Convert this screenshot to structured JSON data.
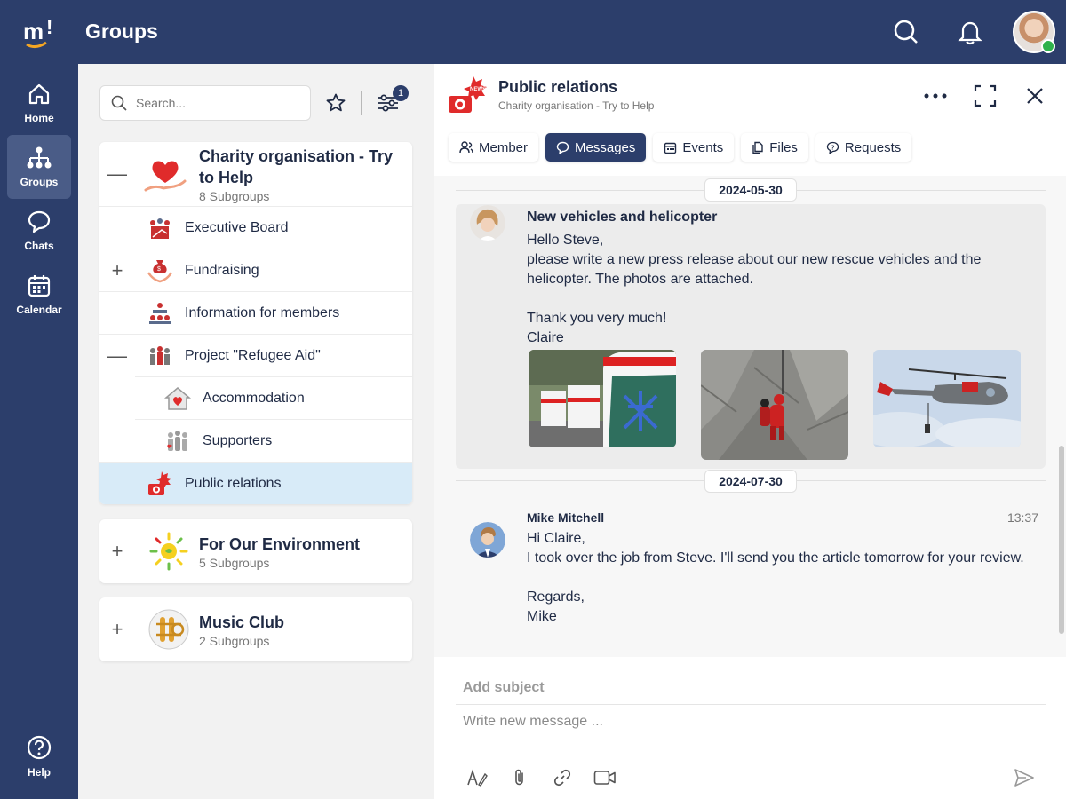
{
  "app": {
    "title": "Groups"
  },
  "nav": {
    "home": "Home",
    "groups": "Groups",
    "chats": "Chats",
    "calendar": "Calendar",
    "help": "Help"
  },
  "search": {
    "placeholder": "Search..."
  },
  "filter": {
    "badge": "1"
  },
  "groups": [
    {
      "title": "Charity organisation - Try to Help",
      "subgroups": "8 Subgroups",
      "children": [
        {
          "label": "Executive Board"
        },
        {
          "label": "Fundraising"
        },
        {
          "label": "Information for members"
        },
        {
          "label": "Project \"Refugee Aid\""
        },
        {
          "label": "Accommodation"
        },
        {
          "label": "Supporters"
        },
        {
          "label": "Public relations"
        }
      ]
    },
    {
      "title": "For Our Environment",
      "subgroups": "5 Subgroups"
    },
    {
      "title": "Music Club",
      "subgroups": "2 Subgroups"
    }
  ],
  "detail": {
    "title": "Public relations",
    "subtitle": "Charity organisation - Try to Help",
    "tabs": [
      "Member",
      "Messages",
      "Events",
      "Files",
      "Requests"
    ],
    "active_tab": "Messages"
  },
  "messages": [
    {
      "date": "2024-05-30",
      "subject": "New vehicles and helicopter",
      "body": "Hello Steve,\nplease write a new press release about our new rescue vehicles and the helicopter. The photos are attached.\n\nThank you very much!\nClaire",
      "attachments": [
        "ambulances",
        "mountain-rescue",
        "helicopter"
      ]
    },
    {
      "date": "2024-07-30",
      "author": "Mike Mitchell",
      "time": "13:37",
      "body": "Hi Claire,\nI took over the job from Steve. I'll send you the article tomorrow for your review.\n\nRegards,\nMike"
    }
  ],
  "composer": {
    "subject_placeholder": "Add subject",
    "message_placeholder": "Write new message ..."
  },
  "colors": {
    "brand": "#2c3e6b",
    "active_row": "#d8ebf8",
    "accent_red": "#e02b2b"
  }
}
